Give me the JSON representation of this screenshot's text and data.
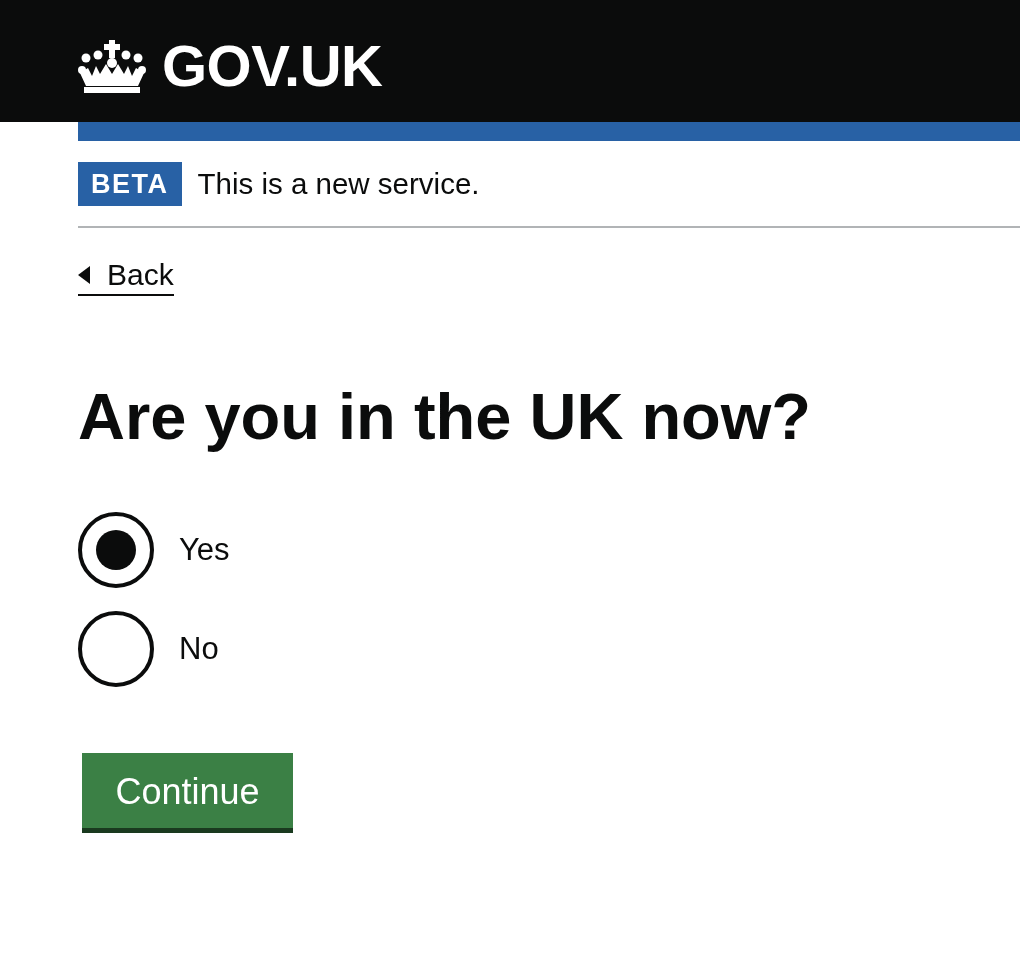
{
  "header": {
    "logo_text": "GOV.UK"
  },
  "phase_banner": {
    "tag": "BETA",
    "text": "This is a new service."
  },
  "back_link": {
    "label": "Back"
  },
  "question": {
    "heading": "Are you in the UK now?",
    "options": [
      {
        "label": "Yes",
        "selected": true
      },
      {
        "label": "No",
        "selected": false
      }
    ]
  },
  "button": {
    "label": "Continue"
  }
}
